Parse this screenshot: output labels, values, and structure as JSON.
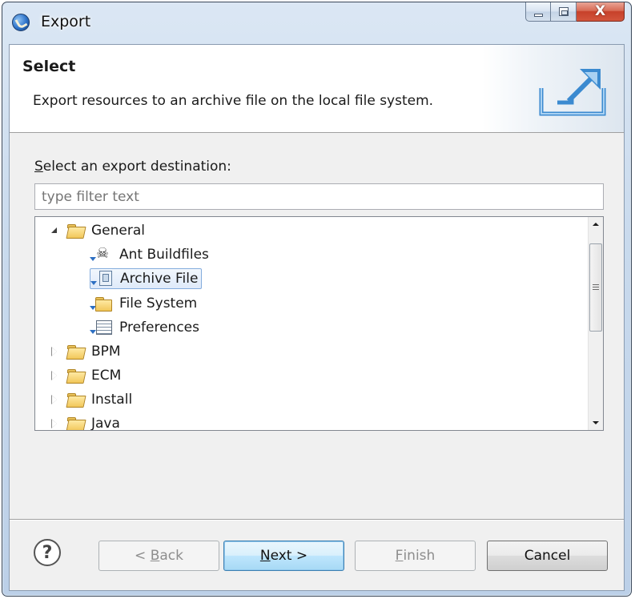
{
  "window": {
    "title": "Export"
  },
  "header": {
    "title": "Select",
    "description": "Export resources to an archive file on the local file system."
  },
  "destination": {
    "label_prefix": "S",
    "label_rest": "elect an export destination:",
    "filter_placeholder": "type filter text"
  },
  "tree": {
    "items": [
      {
        "label": "General",
        "type": "folder",
        "expanded": true
      },
      {
        "label": "Ant Buildfiles",
        "type": "ant"
      },
      {
        "label": "Archive File",
        "type": "archive",
        "selected": true
      },
      {
        "label": "File System",
        "type": "folder"
      },
      {
        "label": "Preferences",
        "type": "preferences"
      },
      {
        "label": "BPM",
        "type": "folder",
        "expanded": false
      },
      {
        "label": "ECM",
        "type": "folder",
        "expanded": false
      },
      {
        "label": "Install",
        "type": "folder",
        "expanded": false
      },
      {
        "label": "Java",
        "type": "folder",
        "expanded": false
      }
    ]
  },
  "buttons": {
    "back_prefix": "< ",
    "back_mnemonic": "B",
    "back_rest": "ack",
    "next_mnemonic": "N",
    "next_rest": "ext >",
    "finish_mnemonic": "F",
    "finish_rest": "inish",
    "cancel": "Cancel",
    "help": "?"
  },
  "caption": {
    "close": "X"
  },
  "colors": {
    "selection": "#dfeafa",
    "default_button": "#bee6fd",
    "close_button": "#c7402a"
  }
}
